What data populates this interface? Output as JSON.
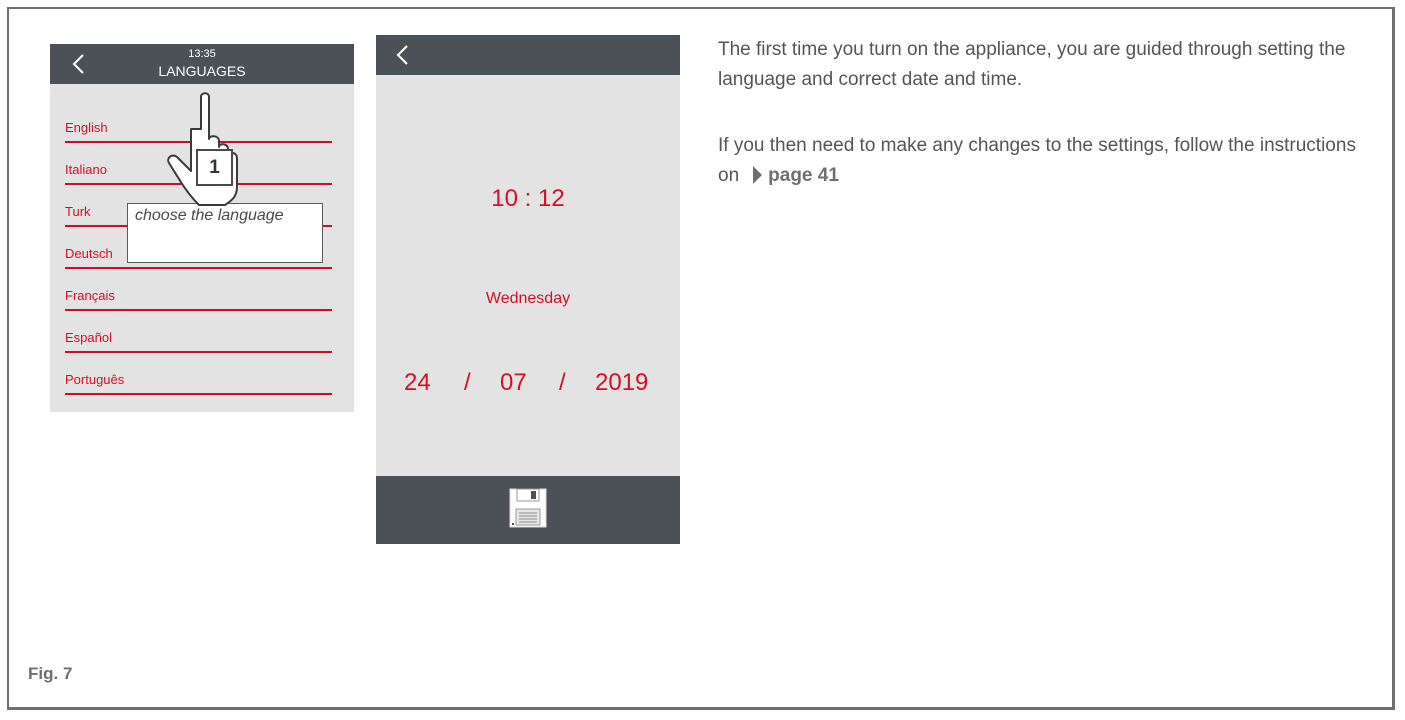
{
  "languages_screen": {
    "time": "13:35",
    "title": "LANGUAGES",
    "items": [
      {
        "label": "English"
      },
      {
        "label": "Italiano"
      },
      {
        "label": "Turk"
      },
      {
        "label": "Deutsch"
      },
      {
        "label": "Français"
      },
      {
        "label": "Español"
      },
      {
        "label": "Português"
      }
    ],
    "step_number": "1",
    "callout": "choose the language",
    "icons": {
      "back": "chevron-left-icon",
      "pointer": "hand-pointer-icon"
    }
  },
  "datetime_screen": {
    "time": "10 : 12",
    "day": "Wednesday",
    "date_day": "24",
    "date_sep1": "/",
    "date_month": "07",
    "date_sep2": "/",
    "date_year": "2019",
    "icons": {
      "back": "chevron-left-icon",
      "save": "floppy-disk-icon"
    }
  },
  "instructions": {
    "paragraph1": "The first time you turn on the appliance, you are guided through setting the language and correct date and time.",
    "paragraph2": "If you then need to make any changes to the settings, follow the instructions on",
    "page_ref": "page 41"
  },
  "figure_label": "Fig. 7",
  "colors": {
    "header": "#4c5157",
    "screen_bg": "#e3e3e3",
    "accent_red": "#d50f25",
    "text_gray": "#555555"
  }
}
